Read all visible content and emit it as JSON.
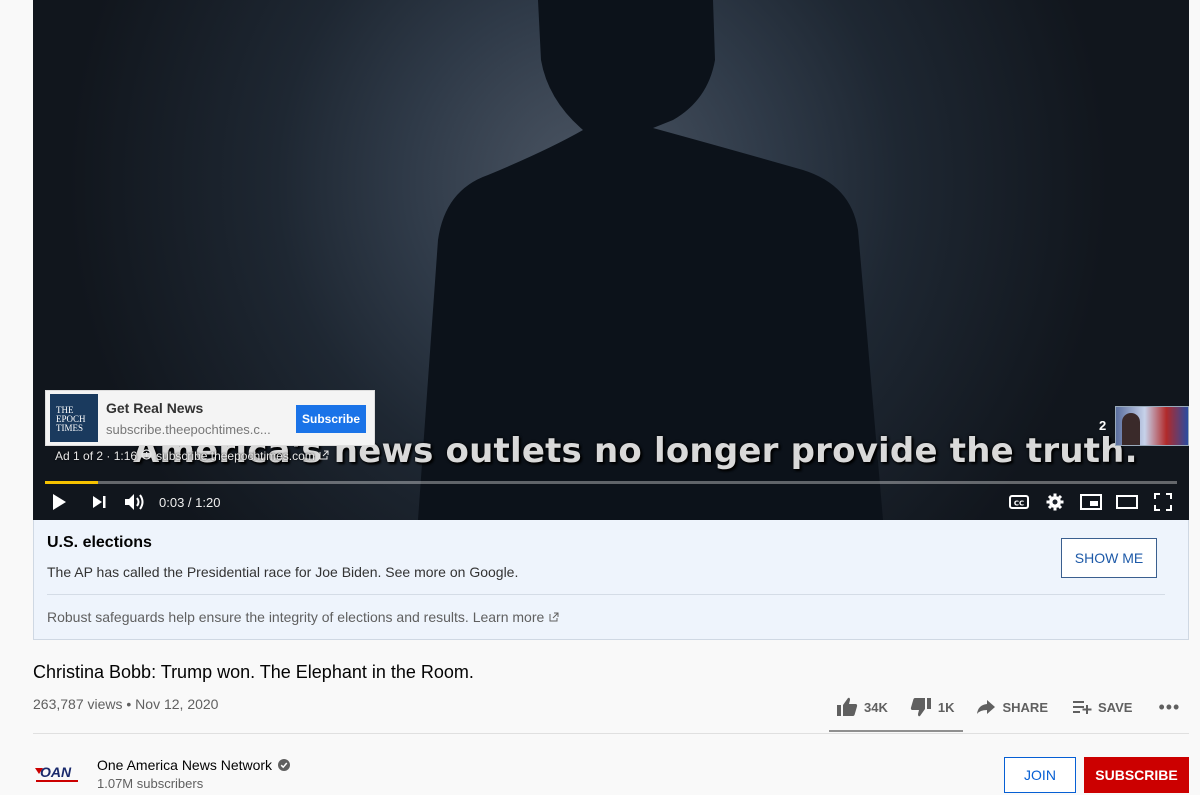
{
  "player": {
    "caption": "America's news outlets no longer provide the truth.",
    "ad": {
      "logo_text": "THE EPOCH TIMES",
      "title": "Get Real News",
      "url": "subscribe.theepochtimes.c...",
      "subscribe_label": "Subscribe",
      "info_position": "Ad 1 of 2 · 1:16",
      "info_url": "subscribe.theepochtimes.com"
    },
    "skip_count": "2",
    "time_display": "0:03 / 1:20",
    "progress_fraction": 0.047,
    "colors": {
      "progress": "#f6c200"
    }
  },
  "election_panel": {
    "title": "U.S. elections",
    "line": "The AP has called the Presidential race for Joe Biden. See more on Google.",
    "show_me_label": "SHOW ME",
    "footer": "Robust safeguards help ensure the integrity of elections and results. Learn more"
  },
  "video": {
    "title": "Christina Bobb: Trump won. The Elephant in the Room.",
    "meta": "263,787 views • Nov 12, 2020",
    "likes": "34K",
    "dislikes": "1K",
    "share_label": "SHARE",
    "save_label": "SAVE",
    "more_label": "•••"
  },
  "channel": {
    "logo_text": "OAN",
    "name": "One America News Network",
    "subscribers": "1.07M subscribers",
    "join_label": "JOIN",
    "subscribe_label": "SUBSCRIBE",
    "colors": {
      "subscribe": "#cc0000",
      "join": "#065fd4"
    }
  }
}
